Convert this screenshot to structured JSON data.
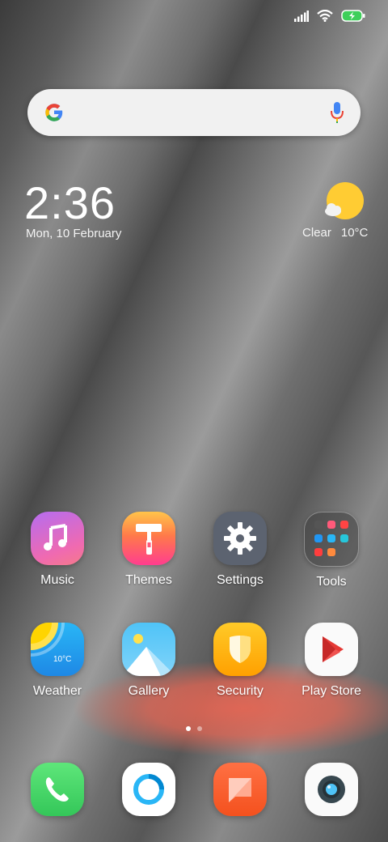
{
  "status_bar": {
    "icons": [
      "signal-icon",
      "wifi-icon",
      "battery-charging-icon"
    ]
  },
  "search": {
    "icons": [
      "google-g-icon",
      "mic-icon"
    ]
  },
  "clock": {
    "time": "2:36",
    "date": "Mon, 10 February"
  },
  "weather": {
    "condition": "Clear",
    "temperature": "10°C",
    "icon": "partly-sunny-icon"
  },
  "apps_row1": [
    {
      "label": "Music",
      "icon": "music-icon"
    },
    {
      "label": "Themes",
      "icon": "paint-roller-icon"
    },
    {
      "label": "Settings",
      "icon": "gear-icon"
    },
    {
      "label": "Tools",
      "icon": "folder-icon"
    }
  ],
  "apps_row2": [
    {
      "label": "Weather",
      "icon": "weather-icon",
      "icon_text": "10°C"
    },
    {
      "label": "Gallery",
      "icon": "gallery-icon"
    },
    {
      "label": "Security",
      "icon": "shield-icon"
    },
    {
      "label": "Play Store",
      "icon": "play-store-icon"
    }
  ],
  "page_indicator": {
    "pages": 2,
    "current": 1
  },
  "dock": [
    {
      "icon": "phone-icon"
    },
    {
      "icon": "browser-icon"
    },
    {
      "icon": "messages-icon"
    },
    {
      "icon": "camera-icon"
    }
  ],
  "colors": {
    "music": "#c36ae8",
    "themes": "#ff4f8a",
    "settings": "#5c6370",
    "security": "#ffb300",
    "phone": "#4cd964",
    "messages": "#ff6a3d"
  }
}
